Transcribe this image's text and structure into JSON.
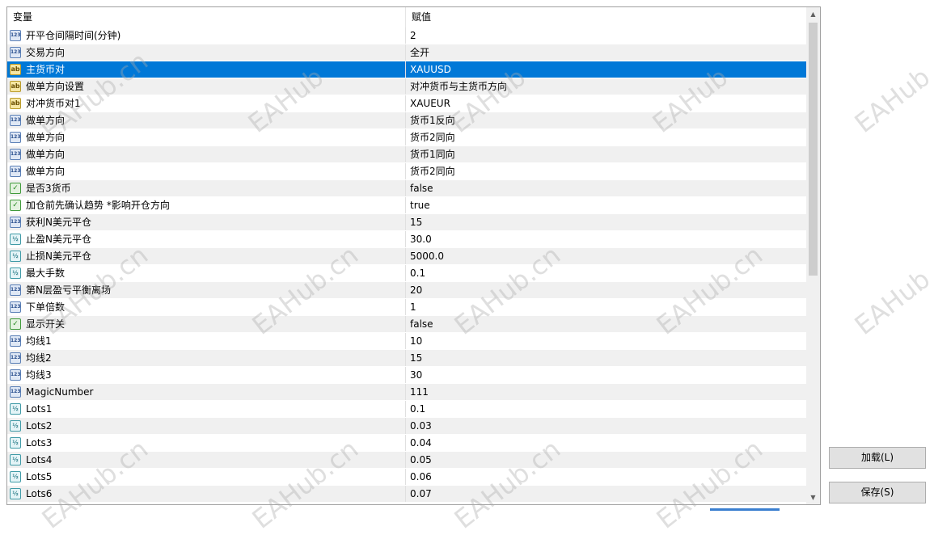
{
  "header": {
    "col_variable": "变量",
    "col_value": "赋值"
  },
  "rows": [
    {
      "icon": "int",
      "icon_text": "123",
      "name": "开平仓间隔时间(分钟)",
      "value": "2"
    },
    {
      "icon": "int",
      "icon_text": "123",
      "name": "交易方向",
      "value": "全开"
    },
    {
      "icon": "str",
      "icon_text": "ab",
      "name": "主货币对",
      "value": "XAUUSD",
      "selected": true
    },
    {
      "icon": "str",
      "icon_text": "ab",
      "name": "做单方向设置",
      "value": "对冲货币与主货币方向"
    },
    {
      "icon": "str",
      "icon_text": "ab",
      "name": "对冲货币对1",
      "value": "XAUEUR"
    },
    {
      "icon": "int",
      "icon_text": "123",
      "name": "做单方向",
      "value": "货币1反向"
    },
    {
      "icon": "int",
      "icon_text": "123",
      "name": "做单方向",
      "value": "货币2同向"
    },
    {
      "icon": "int",
      "icon_text": "123",
      "name": "做单方向",
      "value": "货币1同向"
    },
    {
      "icon": "int",
      "icon_text": "123",
      "name": "做单方向",
      "value": "货币2同向"
    },
    {
      "icon": "bool",
      "icon_text": "✓",
      "name": "是否3货币",
      "value": "false"
    },
    {
      "icon": "bool",
      "icon_text": "✓",
      "name": "加仓前先确认趋势 *影响开仓方向",
      "value": "true"
    },
    {
      "icon": "int",
      "icon_text": "123",
      "name": "获利N美元平仓",
      "value": "15"
    },
    {
      "icon": "dbl",
      "icon_text": "½",
      "name": "止盈N美元平仓",
      "value": "30.0"
    },
    {
      "icon": "dbl",
      "icon_text": "½",
      "name": "止损N美元平仓",
      "value": "5000.0"
    },
    {
      "icon": "dbl",
      "icon_text": "½",
      "name": "最大手数",
      "value": "0.1"
    },
    {
      "icon": "int",
      "icon_text": "123",
      "name": "第N层盈亏平衡离场",
      "value": "20"
    },
    {
      "icon": "int",
      "icon_text": "123",
      "name": "下单倍数",
      "value": "1"
    },
    {
      "icon": "bool",
      "icon_text": "✓",
      "name": "显示开关",
      "value": "false"
    },
    {
      "icon": "int",
      "icon_text": "123",
      "name": "均线1",
      "value": "10"
    },
    {
      "icon": "int",
      "icon_text": "123",
      "name": "均线2",
      "value": "15"
    },
    {
      "icon": "int",
      "icon_text": "123",
      "name": "均线3",
      "value": "30"
    },
    {
      "icon": "int",
      "icon_text": "123",
      "name": "MagicNumber",
      "value": "111"
    },
    {
      "icon": "dbl",
      "icon_text": "½",
      "name": "Lots1",
      "value": "0.1"
    },
    {
      "icon": "dbl",
      "icon_text": "½",
      "name": "Lots2",
      "value": "0.03"
    },
    {
      "icon": "dbl",
      "icon_text": "½",
      "name": "Lots3",
      "value": "0.04"
    },
    {
      "icon": "dbl",
      "icon_text": "½",
      "name": "Lots4",
      "value": "0.05"
    },
    {
      "icon": "dbl",
      "icon_text": "½",
      "name": "Lots5",
      "value": "0.06"
    },
    {
      "icon": "dbl",
      "icon_text": "½",
      "name": "Lots6",
      "value": "0.07"
    }
  ],
  "buttons": {
    "load": "加载(L)",
    "save": "保存(S)"
  },
  "watermark_text": "EAHub.cn",
  "watermark_text_short": "EAHub",
  "colors": {
    "selected_row": "#0078d7",
    "alt_row": "#f0f0f0"
  }
}
